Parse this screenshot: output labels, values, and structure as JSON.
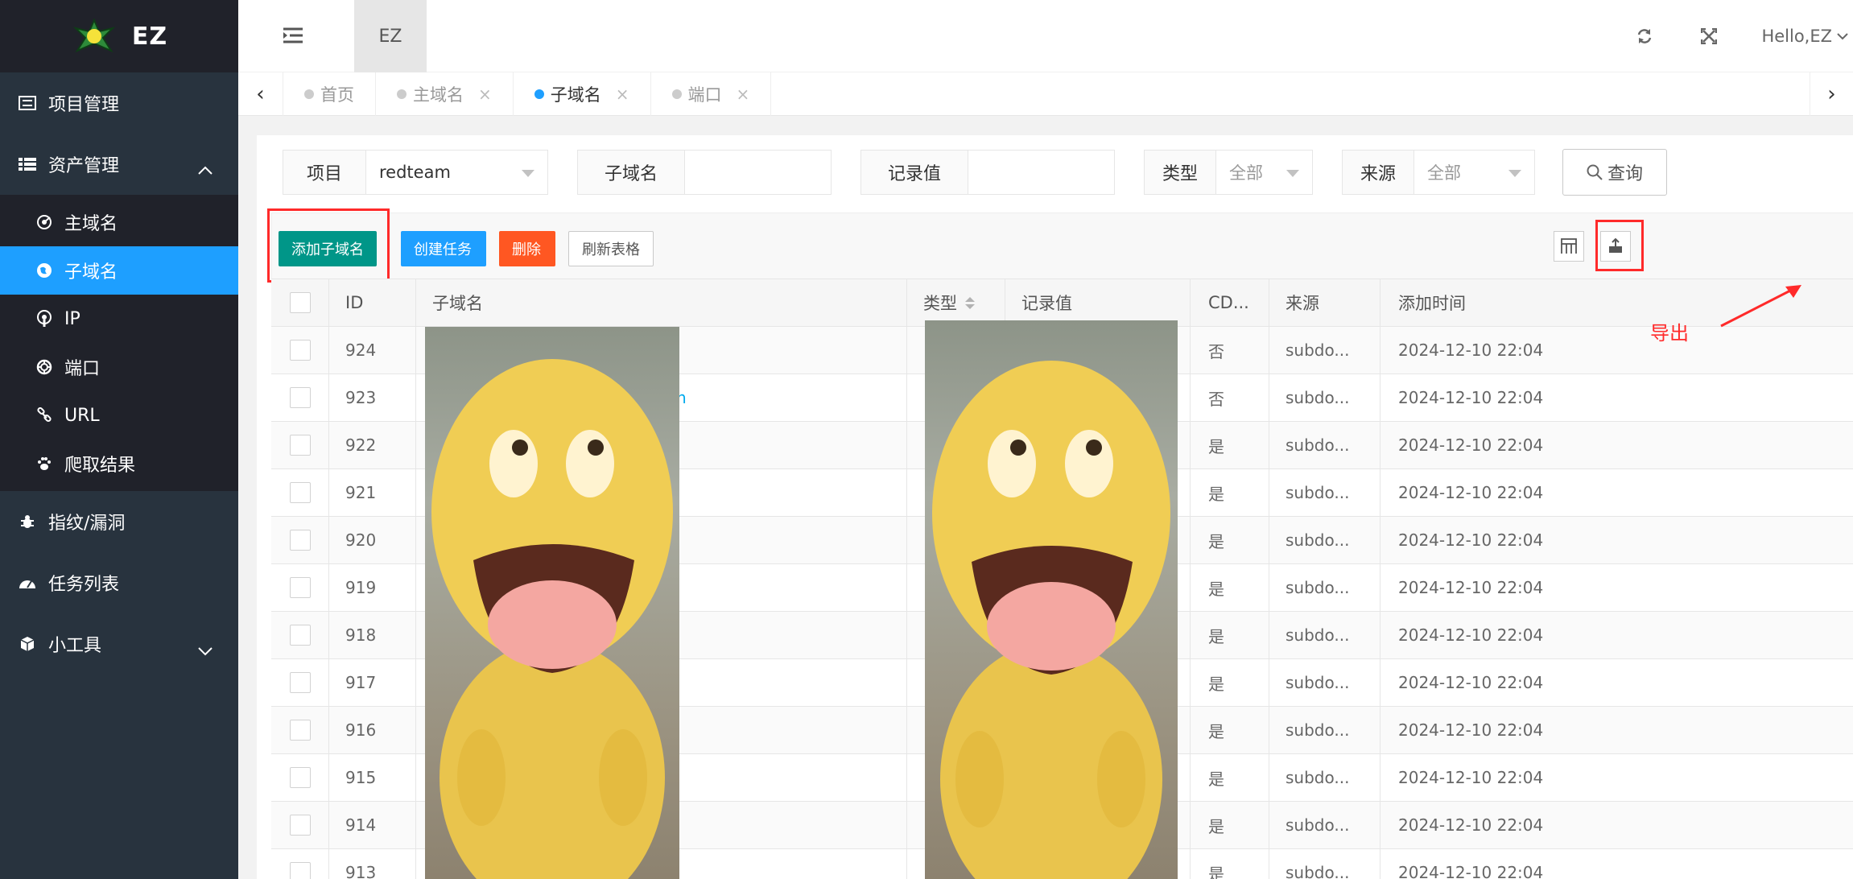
{
  "app": {
    "logo_text": "EZ"
  },
  "header": {
    "tab_label": "EZ",
    "greeting": "Hello,EZ"
  },
  "sidebar": {
    "items": [
      {
        "label": "项目管理",
        "icon": "list-icon"
      },
      {
        "label": "资产管理",
        "icon": "table-icon",
        "expanded": true
      },
      {
        "label": "指纹/漏洞",
        "icon": "bug-icon"
      },
      {
        "label": "任务列表",
        "icon": "dashboard-icon"
      },
      {
        "label": "小工具",
        "icon": "cube-icon",
        "expanded": false
      }
    ],
    "sub_items": [
      {
        "label": "主域名",
        "icon": "radar-icon"
      },
      {
        "label": "子域名",
        "icon": "globe-icon",
        "active": true
      },
      {
        "label": "IP",
        "icon": "podcast-icon"
      },
      {
        "label": "端口",
        "icon": "lifebuoy-icon"
      },
      {
        "label": "URL",
        "icon": "link-icon"
      },
      {
        "label": "爬取结果",
        "icon": "paw-icon"
      }
    ]
  },
  "tabs": [
    {
      "label": "首页",
      "active": false
    },
    {
      "label": "主域名",
      "active": false
    },
    {
      "label": "子域名",
      "active": true
    },
    {
      "label": "端口",
      "active": false
    }
  ],
  "filter": {
    "project_label": "项目",
    "project_value": "redteam",
    "subdomain_label": "子域名",
    "subdomain_value": "",
    "record_label": "记录值",
    "record_value": "",
    "type_label": "类型",
    "type_value": "全部",
    "source_label": "来源",
    "source_value": "全部",
    "query_label": "查询"
  },
  "toolbar": {
    "add": "添加子域名",
    "create_task": "创建任务",
    "delete": "删除",
    "refresh": "刷新表格"
  },
  "annotation": {
    "text": "导出"
  },
  "table": {
    "columns": [
      "ID",
      "子域名",
      "类型",
      "记录值",
      "CD...",
      "来源",
      "添加时间"
    ],
    "rows": [
      {
        "id": "924",
        "subdomain": "",
        "cdn": "否",
        "source": "subdo...",
        "time": "2024-12-10 22:04"
      },
      {
        "id": "923",
        "subdomain": "om",
        "cdn": "否",
        "source": "subdo...",
        "time": "2024-12-10 22:04"
      },
      {
        "id": "922",
        "subdomain": "",
        "cdn": "是",
        "source": "subdo...",
        "time": "2024-12-10 22:04"
      },
      {
        "id": "921",
        "subdomain": "",
        "cdn": "是",
        "source": "subdo...",
        "time": "2024-12-10 22:04"
      },
      {
        "id": "920",
        "subdomain": "",
        "cdn": "是",
        "source": "subdo...",
        "time": "2024-12-10 22:04"
      },
      {
        "id": "919",
        "subdomain": "",
        "cdn": "是",
        "source": "subdo...",
        "time": "2024-12-10 22:04"
      },
      {
        "id": "918",
        "subdomain": "",
        "cdn": "是",
        "source": "subdo...",
        "time": "2024-12-10 22:04"
      },
      {
        "id": "917",
        "subdomain": "",
        "cdn": "是",
        "source": "subdo...",
        "time": "2024-12-10 22:04"
      },
      {
        "id": "916",
        "subdomain": "",
        "cdn": "是",
        "source": "subdo...",
        "time": "2024-12-10 22:04"
      },
      {
        "id": "915",
        "subdomain": "",
        "cdn": "是",
        "source": "subdo...",
        "time": "2024-12-10 22:04"
      },
      {
        "id": "914",
        "subdomain": "",
        "cdn": "是",
        "source": "subdo...",
        "time": "2024-12-10 22:04"
      },
      {
        "id": "913",
        "subdomain": "",
        "cdn": "是",
        "source": "subdo...",
        "time": "2024-12-10 22:04"
      }
    ]
  }
}
